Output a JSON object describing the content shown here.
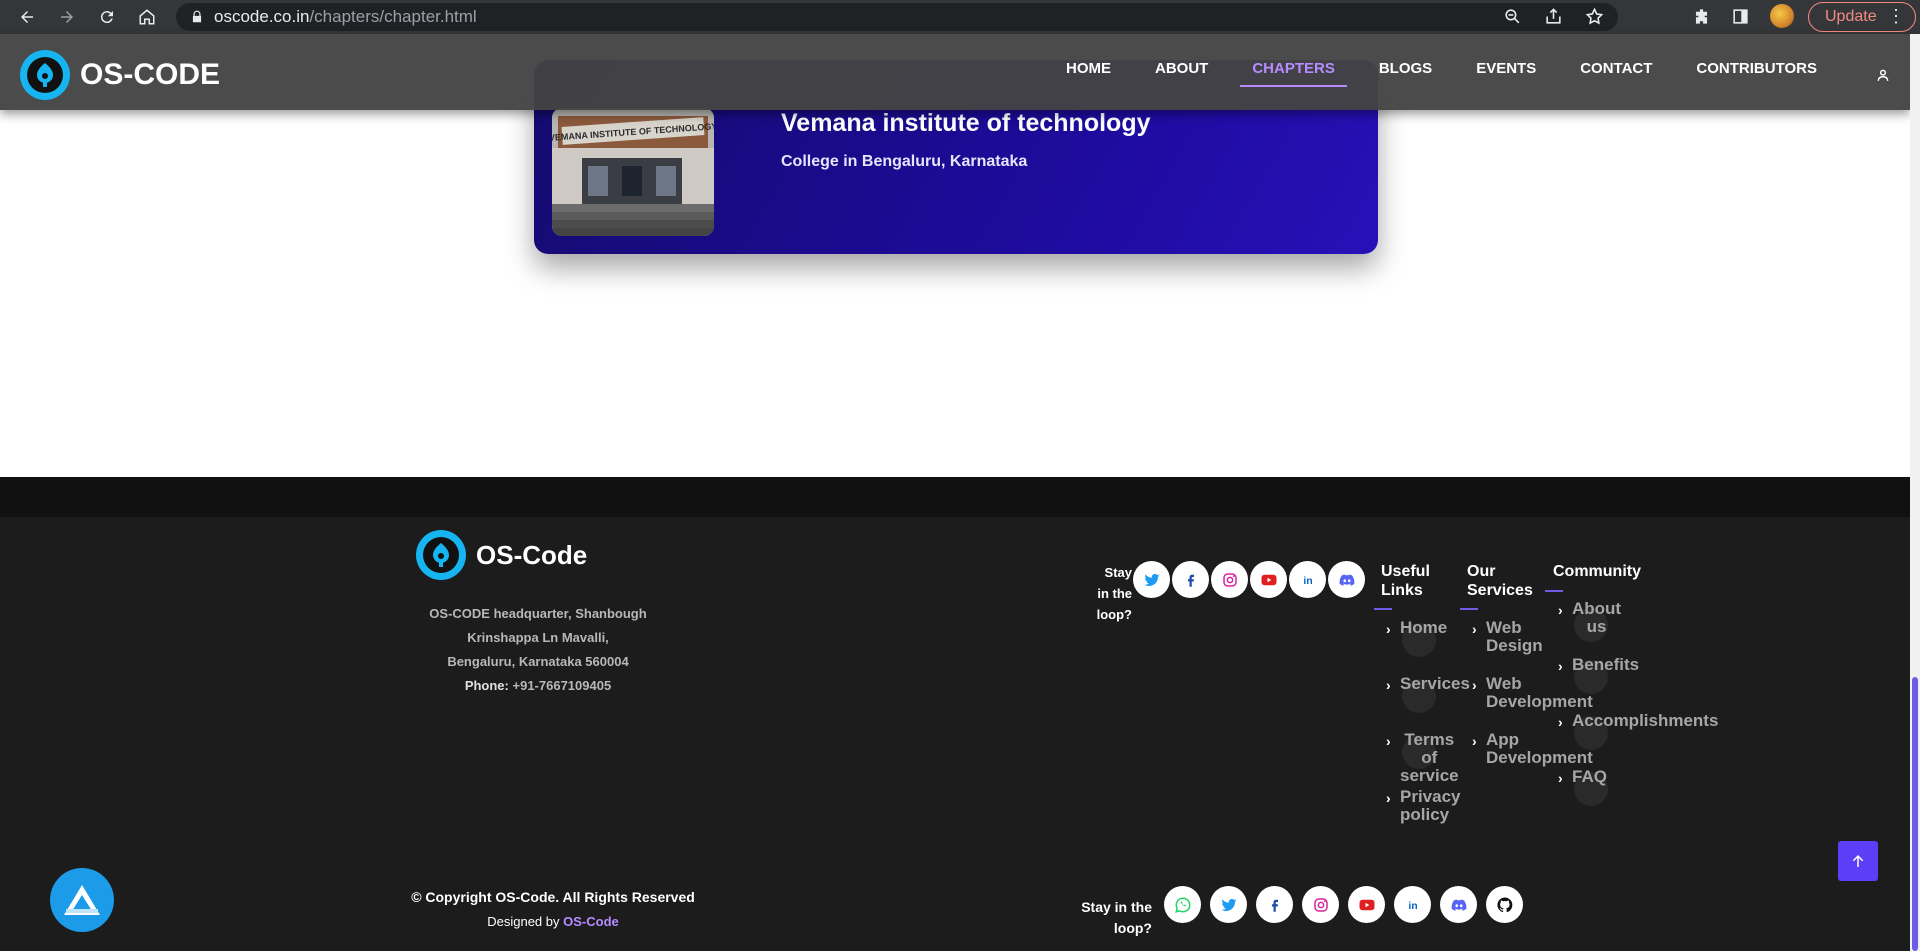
{
  "browser": {
    "url_domain": "oscode.co.in",
    "url_path": "/chapters/chapter.html",
    "update_label": "Update"
  },
  "header": {
    "logo_text": "OS-CODE",
    "nav": [
      {
        "label": "HOME"
      },
      {
        "label": "ABOUT"
      },
      {
        "label": "CHAPTERS",
        "active": true
      },
      {
        "label": "BLOGS"
      },
      {
        "label": "EVENTS"
      },
      {
        "label": "CONTACT"
      },
      {
        "label": "CONTRIBUTORS"
      }
    ]
  },
  "card": {
    "name": "Vemana institute of technology",
    "location": "College in Bengaluru, Karnataka",
    "image_sign": "VEMANA INSTITUTE OF TECHNOLOGY"
  },
  "footer": {
    "logo_text": "OS-Code",
    "address_line1": "OS-CODE headquarter, Shanbough",
    "address_line2": "Krinshappa Ln Mavalli,",
    "address_line3": "Bengaluru, Karnataka 560004",
    "phone_label": "Phone:",
    "phone": "+91-7667109405",
    "stay_line1": "Stay",
    "stay_line2": "in the",
    "stay_line3": "loop?",
    "useful_links": {
      "heading_line1": "Useful",
      "heading_line2": "Links",
      "home": "Home",
      "services": "Services",
      "terms_1": "Terms",
      "terms_2": "of",
      "terms_3": "service",
      "privacy_1": "Privacy",
      "privacy_2": "policy"
    },
    "our_services": {
      "heading_line1": "Our",
      "heading_line2": "Services",
      "web_design_1": "Web",
      "web_design_2": "Design",
      "web_dev_1": "Web",
      "web_dev_2": "Development",
      "app_dev_1": "App",
      "app_dev_2": "Development"
    },
    "community": {
      "heading": "Community",
      "about_1": "About",
      "about_2": "us",
      "benefits": "Benefits",
      "accomplishments": "Accomplishments",
      "faq": "FAQ"
    },
    "copyright_prefix": "© Copyright ",
    "copyright_brand": "OS-Code",
    "copyright_suffix": ". All Rights Reserved",
    "designed_prefix": "Designed by ",
    "designed_brand": "OS-Code",
    "stay2_line1": "Stay in the",
    "stay2_line2": "loop?"
  },
  "colors": {
    "accent": "#6c5ce7",
    "brand_purple": "#b68cff",
    "card_gradient_start": "#150b6e",
    "card_gradient_end": "#2810b8",
    "logo_blue": "#16b4f0"
  },
  "icons": {
    "social_row1": [
      "twitter-icon",
      "facebook-icon",
      "instagram-icon",
      "youtube-icon",
      "linkedin-icon",
      "discord-icon"
    ],
    "social_row2": [
      "whatsapp-icon",
      "twitter-icon",
      "facebook-icon",
      "instagram-icon",
      "youtube-icon",
      "linkedin-icon",
      "discord-icon",
      "github-icon"
    ]
  }
}
